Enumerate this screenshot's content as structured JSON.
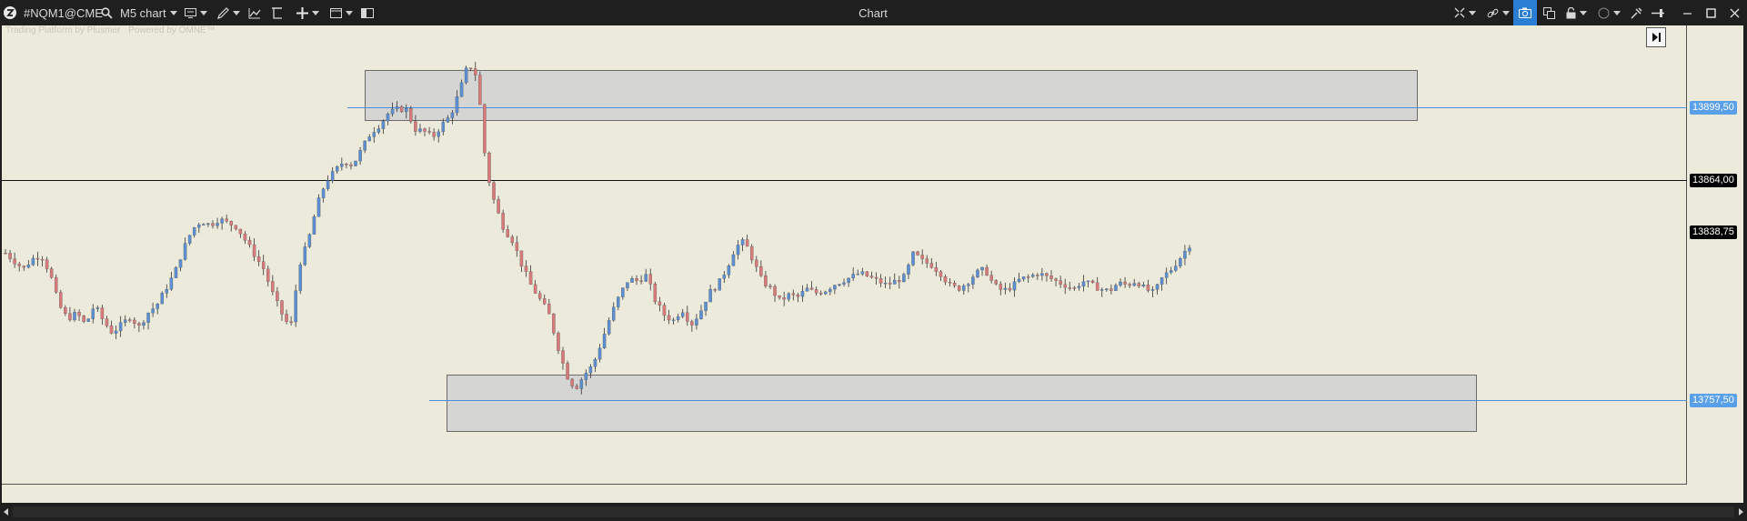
{
  "titlebar": {
    "symbol": "#NQM1@CME",
    "chart_type_label": "M5 chart",
    "window_title": "Chart",
    "icons": [
      "app-logo-icon",
      "search-icon",
      "display-icon",
      "pencil-icon",
      "line-chart-icon",
      "shapes-icon",
      "crosshair-icon",
      "window-icon",
      "layout-icon",
      "compress-icon",
      "link-icon",
      "camera-icon",
      "copy-icon",
      "lock-icon",
      "circle-icon",
      "tools-icon",
      "pin-icon",
      "minimize-icon",
      "maximize-icon",
      "close-icon"
    ]
  },
  "watermark": {
    "line1": "Trading Platform by Plusmer",
    "line2": "Powered by OMNE™"
  },
  "price_levels": {
    "upper_zone_line": "13899,50",
    "current_line": "13864,00",
    "last_price": "13838,75",
    "lower_zone_line": "13757,50"
  },
  "colors": {
    "background": "#eceadb",
    "bull_candle": "#5b8fd1",
    "bear_candle": "#d97a7a",
    "zone_fill": "#d3d3d6",
    "zone_line": "#4a90e2",
    "price_line": "#000000",
    "tag_blue": "#5aa0e8",
    "tag_black": "#000000"
  },
  "chart_data": {
    "type": "candlestick",
    "instrument": "#NQM1@CME",
    "timeframe": "M5",
    "y_range": [
      13700,
      13930
    ],
    "zones": [
      {
        "from": 13885,
        "to": 13911,
        "line": 13899.5
      },
      {
        "from": 13733,
        "to": 13763,
        "line": 13757.5
      }
    ],
    "close_path": [
      13816,
      13812,
      13808,
      13813,
      13815,
      13806,
      13790,
      13783,
      13786,
      13780,
      13790,
      13782,
      13776,
      13780,
      13784,
      13779,
      13786,
      13790,
      13798,
      13806,
      13818,
      13828,
      13832,
      13830,
      13833,
      13831,
      13829,
      13822,
      13815,
      13808,
      13796,
      13786,
      13778,
      13810,
      13822,
      13840,
      13852,
      13857,
      13862,
      13860,
      13868,
      13876,
      13880,
      13886,
      13888,
      13888,
      13878,
      13877,
      13874,
      13880,
      13885,
      13897,
      13911,
      13904,
      13858,
      13840,
      13828,
      13822,
      13810,
      13800,
      13793,
      13786,
      13770,
      13755,
      13748,
      13755,
      13760,
      13772,
      13785,
      13795,
      13803,
      13802,
      13805,
      13792,
      13785,
      13782,
      13788,
      13780,
      13786,
      13796,
      13800,
      13808,
      13819,
      13822,
      13812,
      13802,
      13798,
      13792,
      13795,
      13794,
      13798,
      13796,
      13797,
      13800,
      13802,
      13804,
      13806,
      13804,
      13802,
      13800,
      13802,
      13804,
      13816,
      13812,
      13810,
      13806,
      13800,
      13798,
      13801,
      13806,
      13808,
      13800,
      13797,
      13799,
      13803,
      13804,
      13806,
      13804,
      13802,
      13800,
      13798,
      13802,
      13800,
      13798,
      13797,
      13801,
      13800,
      13802,
      13798,
      13796,
      13804,
      13808,
      13814,
      13820
    ]
  }
}
